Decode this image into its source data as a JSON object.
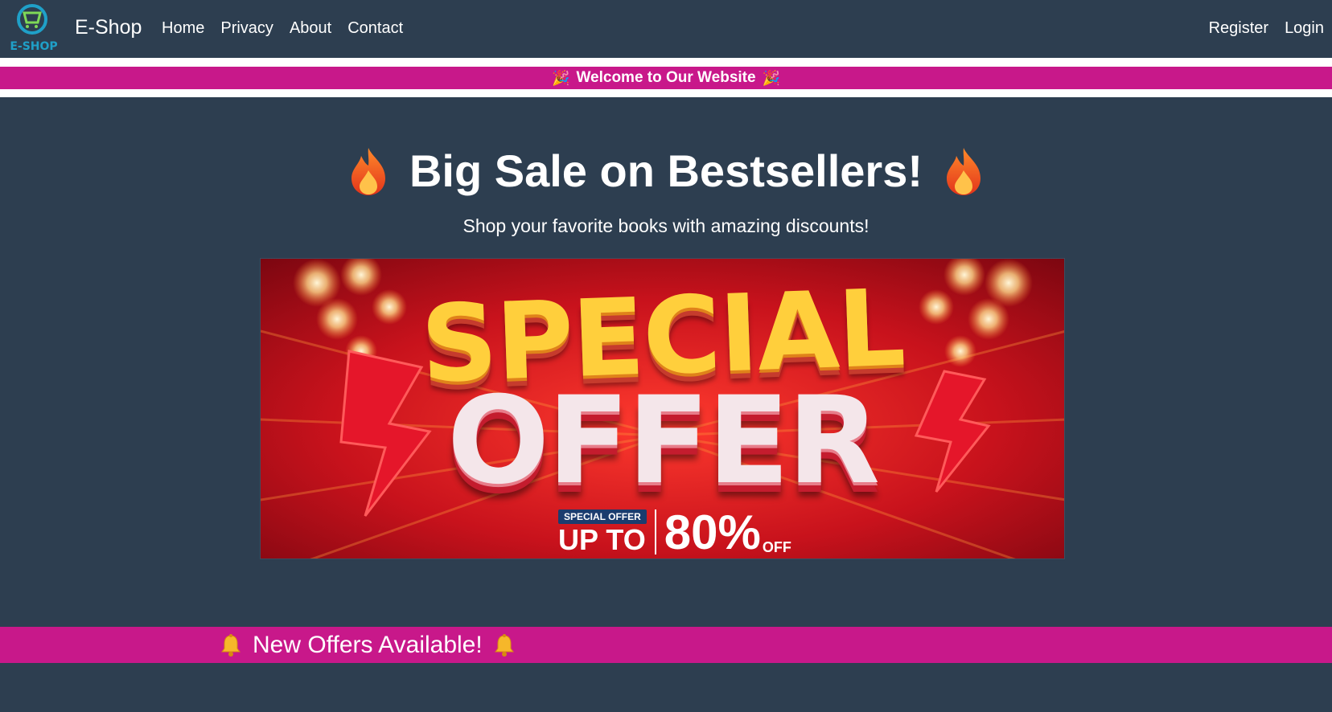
{
  "navbar": {
    "brand": "E-Shop",
    "logo_text": "E-SHOP",
    "links": [
      "Home",
      "Privacy",
      "About",
      "Contact"
    ],
    "right_links": [
      "Register",
      "Login"
    ]
  },
  "welcome": {
    "text": "Welcome to Our Website",
    "icon": "party-popper-icon"
  },
  "hero": {
    "title": "Big Sale on Bestsellers!",
    "subtitle": "Shop your favorite books with amazing discounts!",
    "icon": "fire-icon"
  },
  "banner": {
    "line1": "SPECIAL",
    "line2": "OFFER",
    "badge": "SPECIAL OFFER",
    "up_to": "UP TO",
    "percent": "80%",
    "off": "OFF"
  },
  "offers": {
    "text": "New Offers Available!",
    "icon": "bell-icon"
  },
  "colors": {
    "background": "#2d3e50",
    "accent": "#c8188a",
    "banner_red": "#c4101e",
    "banner_yellow": "#ffcf3c"
  }
}
